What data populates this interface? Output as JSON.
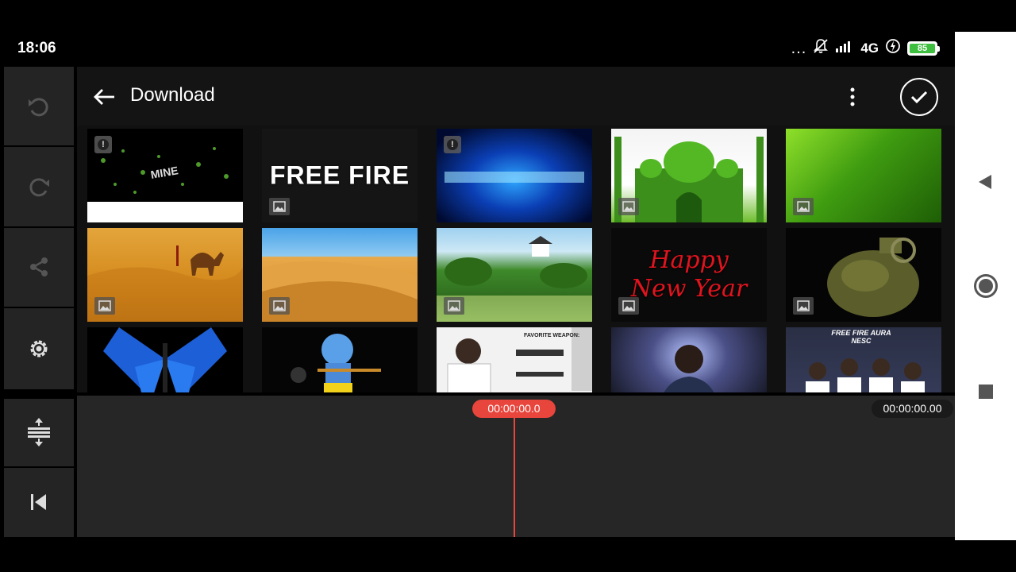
{
  "status_bar": {
    "time": "18:06",
    "more_dots": "...",
    "network": "4G",
    "battery": "85",
    "battery_color": "#3fbf3f"
  },
  "rail": {
    "items": [
      {
        "name": "undo",
        "icon": "undo-icon"
      },
      {
        "name": "redo",
        "icon": "redo-icon"
      },
      {
        "name": "share",
        "icon": "share-icon"
      },
      {
        "name": "settings",
        "icon": "gear-icon"
      },
      {
        "name": "expand-timeline",
        "icon": "expand-vertical-icon"
      },
      {
        "name": "jump-to-start",
        "icon": "skip-to-start-icon"
      }
    ]
  },
  "browser": {
    "title": "Download",
    "thumbnails": [
      {
        "id": "t1",
        "label": "",
        "badge": "warning"
      },
      {
        "id": "t2",
        "label": "FREE FIRE",
        "badge": "image"
      },
      {
        "id": "t3",
        "label": "",
        "badge": "warning"
      },
      {
        "id": "t4",
        "label": "",
        "badge": "image"
      },
      {
        "id": "t5",
        "label": "",
        "badge": "image"
      },
      {
        "id": "t6",
        "label": "",
        "badge": "image"
      },
      {
        "id": "t7",
        "label": "",
        "badge": "image"
      },
      {
        "id": "t8",
        "label": "",
        "badge": "image"
      },
      {
        "id": "t9",
        "label": "Happy New Year",
        "badge": "image"
      },
      {
        "id": "t10",
        "label": "",
        "badge": "image"
      },
      {
        "id": "t11",
        "label": "",
        "badge": "none"
      },
      {
        "id": "t12",
        "label": "",
        "badge": "none"
      },
      {
        "id": "t13",
        "label": "FAVORITE WEAPON:",
        "badge": "none"
      },
      {
        "id": "t14",
        "label": "",
        "badge": "none"
      },
      {
        "id": "t15",
        "label": "FREE FIRE AURA NESC",
        "badge": "none"
      }
    ]
  },
  "timeline": {
    "playhead_time": "00:00:00.0",
    "total_time": "00:00:00.00",
    "playhead_color": "#e8453c"
  }
}
